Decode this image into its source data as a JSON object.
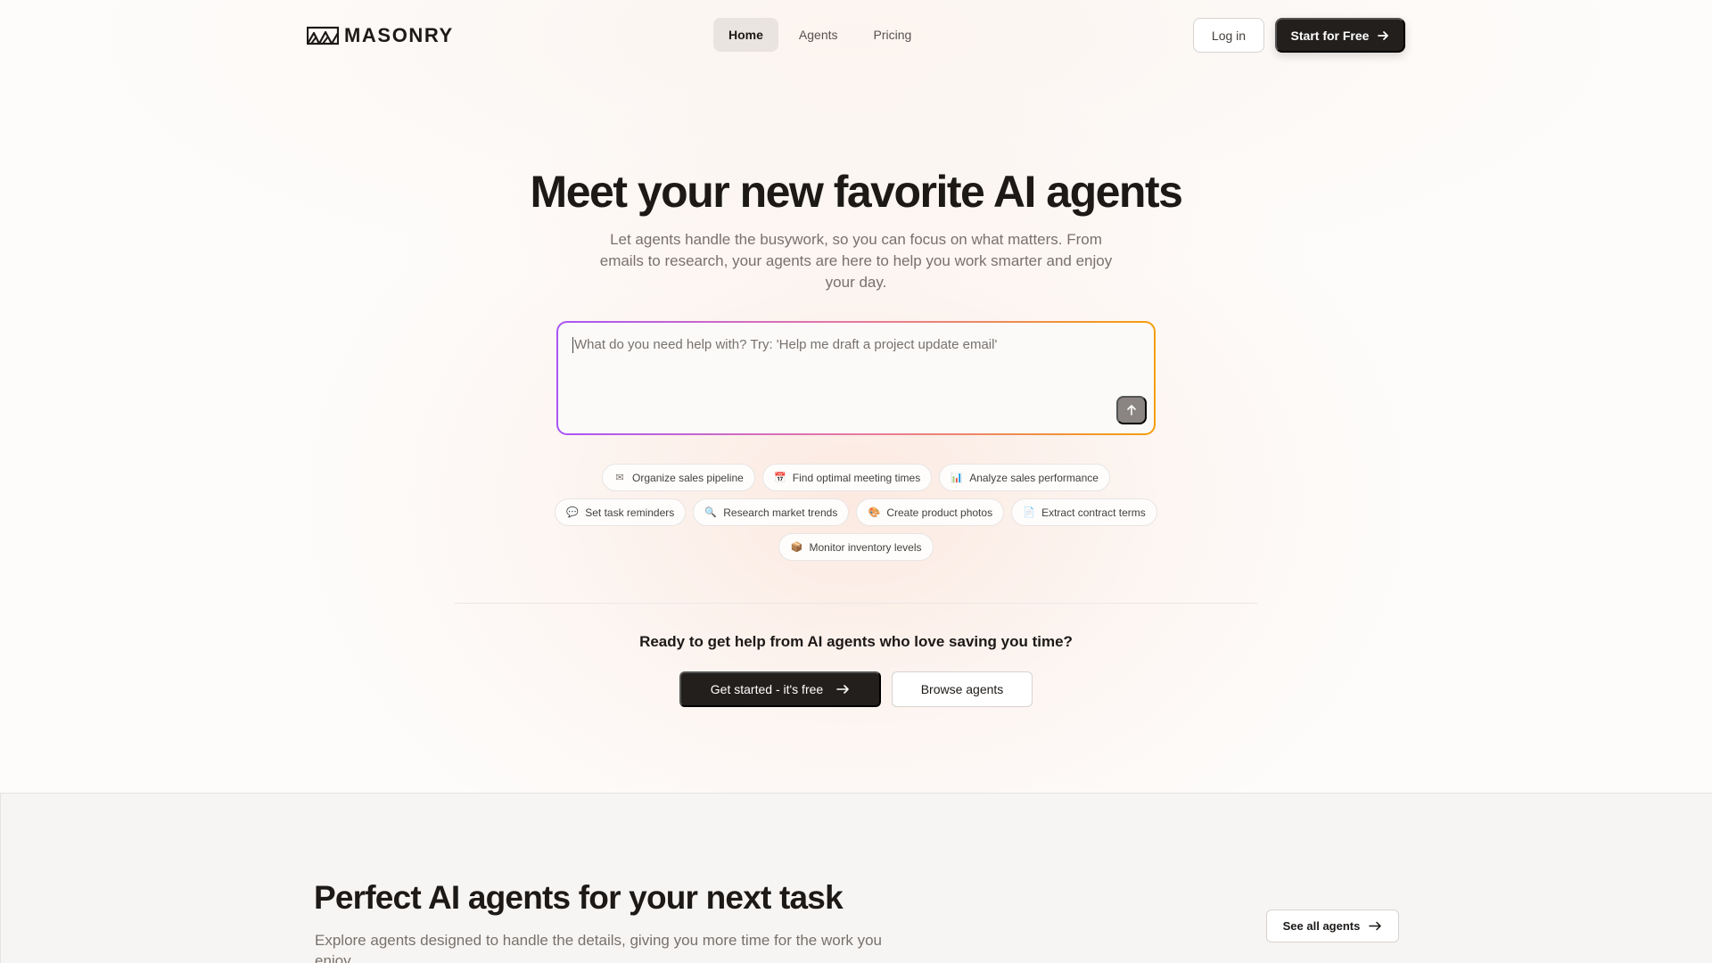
{
  "brand": {
    "name": "MASONRY"
  },
  "nav": {
    "links": [
      {
        "label": "Home",
        "active": true
      },
      {
        "label": "Agents",
        "active": false
      },
      {
        "label": "Pricing",
        "active": false
      }
    ],
    "login_label": "Log in",
    "start_label": "Start for Free"
  },
  "hero": {
    "title": "Meet your new favorite AI agents",
    "subtitle": "Let agents handle the busywork, so you can focus on what matters. From emails to research, your agents are here to help you work smarter and enjoy your day.",
    "prompt_placeholder": "What do you need help with? Try: 'Help me draft a project update email'"
  },
  "suggestions": [
    [
      {
        "icon": "envelope-icon",
        "glyph": "✉",
        "label": "Organize sales pipeline"
      },
      {
        "icon": "calendar-icon",
        "glyph": "📅",
        "label": "Find optimal meeting times"
      },
      {
        "icon": "bar-chart-icon",
        "glyph": "📊",
        "label": "Analyze sales performance"
      }
    ],
    [
      {
        "icon": "chat-bubble-icon",
        "glyph": "💬",
        "label": "Set task reminders"
      },
      {
        "icon": "magnifier-icon",
        "glyph": "🔍",
        "label": "Research market trends"
      },
      {
        "icon": "palette-icon",
        "glyph": "🎨",
        "label": "Create product photos"
      },
      {
        "icon": "document-icon",
        "glyph": "📄",
        "label": "Extract contract terms"
      }
    ],
    [
      {
        "icon": "package-icon",
        "glyph": "📦",
        "label": "Monitor inventory levels"
      }
    ]
  ],
  "cta": {
    "heading": "Ready to get help from AI agents who love saving you time?",
    "primary_label": "Get started - it's free",
    "secondary_label": "Browse agents"
  },
  "section": {
    "title": "Perfect AI agents for your next task",
    "subtitle": "Explore agents designed to handle the details, giving you more time for the work you enjoy.",
    "see_all_label": "See all agents"
  },
  "colors": {
    "primary_dark": "#231f1d",
    "gradient_start": "#a855f7",
    "gradient_end": "#f59e0b"
  }
}
